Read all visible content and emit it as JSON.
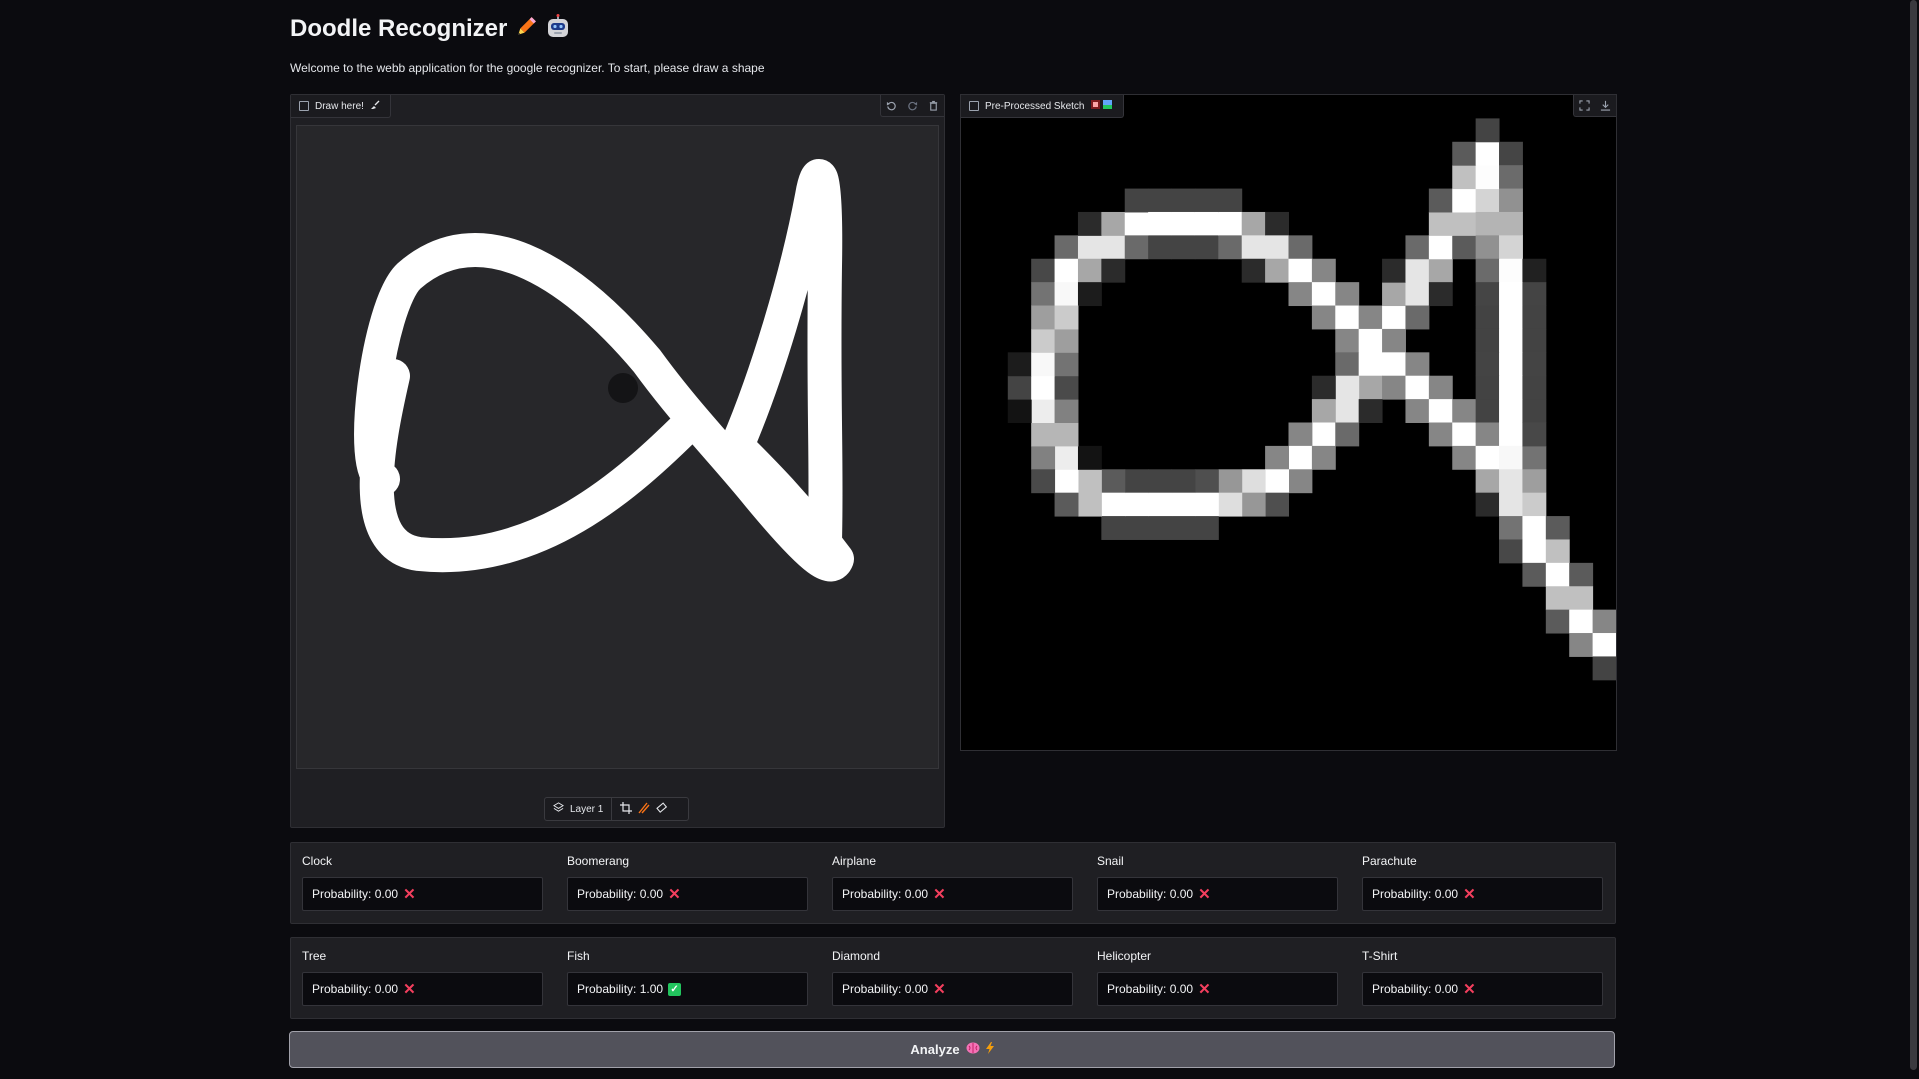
{
  "header": {
    "title": "Doodle Recognizer",
    "subtitle": "Welcome to the webb application for the google recognizer. To start, please draw a shape"
  },
  "draw_panel": {
    "label": "Draw here!",
    "layer_label": "Layer 1"
  },
  "preprocessed_panel": {
    "label": "Pre-Processed Sketch"
  },
  "results": {
    "row1": [
      {
        "name": "Clock",
        "text": "Probability: 0.00",
        "status": "x"
      },
      {
        "name": "Boomerang",
        "text": "Probability: 0.00",
        "status": "x"
      },
      {
        "name": "Airplane",
        "text": "Probability: 0.00",
        "status": "x"
      },
      {
        "name": "Snail",
        "text": "Probability: 0.00",
        "status": "x"
      },
      {
        "name": "Parachute",
        "text": "Probability: 0.00",
        "status": "x"
      }
    ],
    "row2": [
      {
        "name": "Tree",
        "text": "Probability: 0.00",
        "status": "x"
      },
      {
        "name": "Fish",
        "text": "Probability: 1.00",
        "status": "check"
      },
      {
        "name": "Diamond",
        "text": "Probability: 0.00",
        "status": "x"
      },
      {
        "name": "Helicopter",
        "text": "Probability: 0.00",
        "status": "x"
      },
      {
        "name": "T-Shirt",
        "text": "Probability: 0.00",
        "status": "x"
      }
    ]
  },
  "analyze_button": {
    "label": "Analyze"
  },
  "colors": {
    "background": "#0b0b0f",
    "panel": "#1f1f23",
    "x_mark": "#f43f5e",
    "check": "#22c55e",
    "button": "#52525b"
  }
}
